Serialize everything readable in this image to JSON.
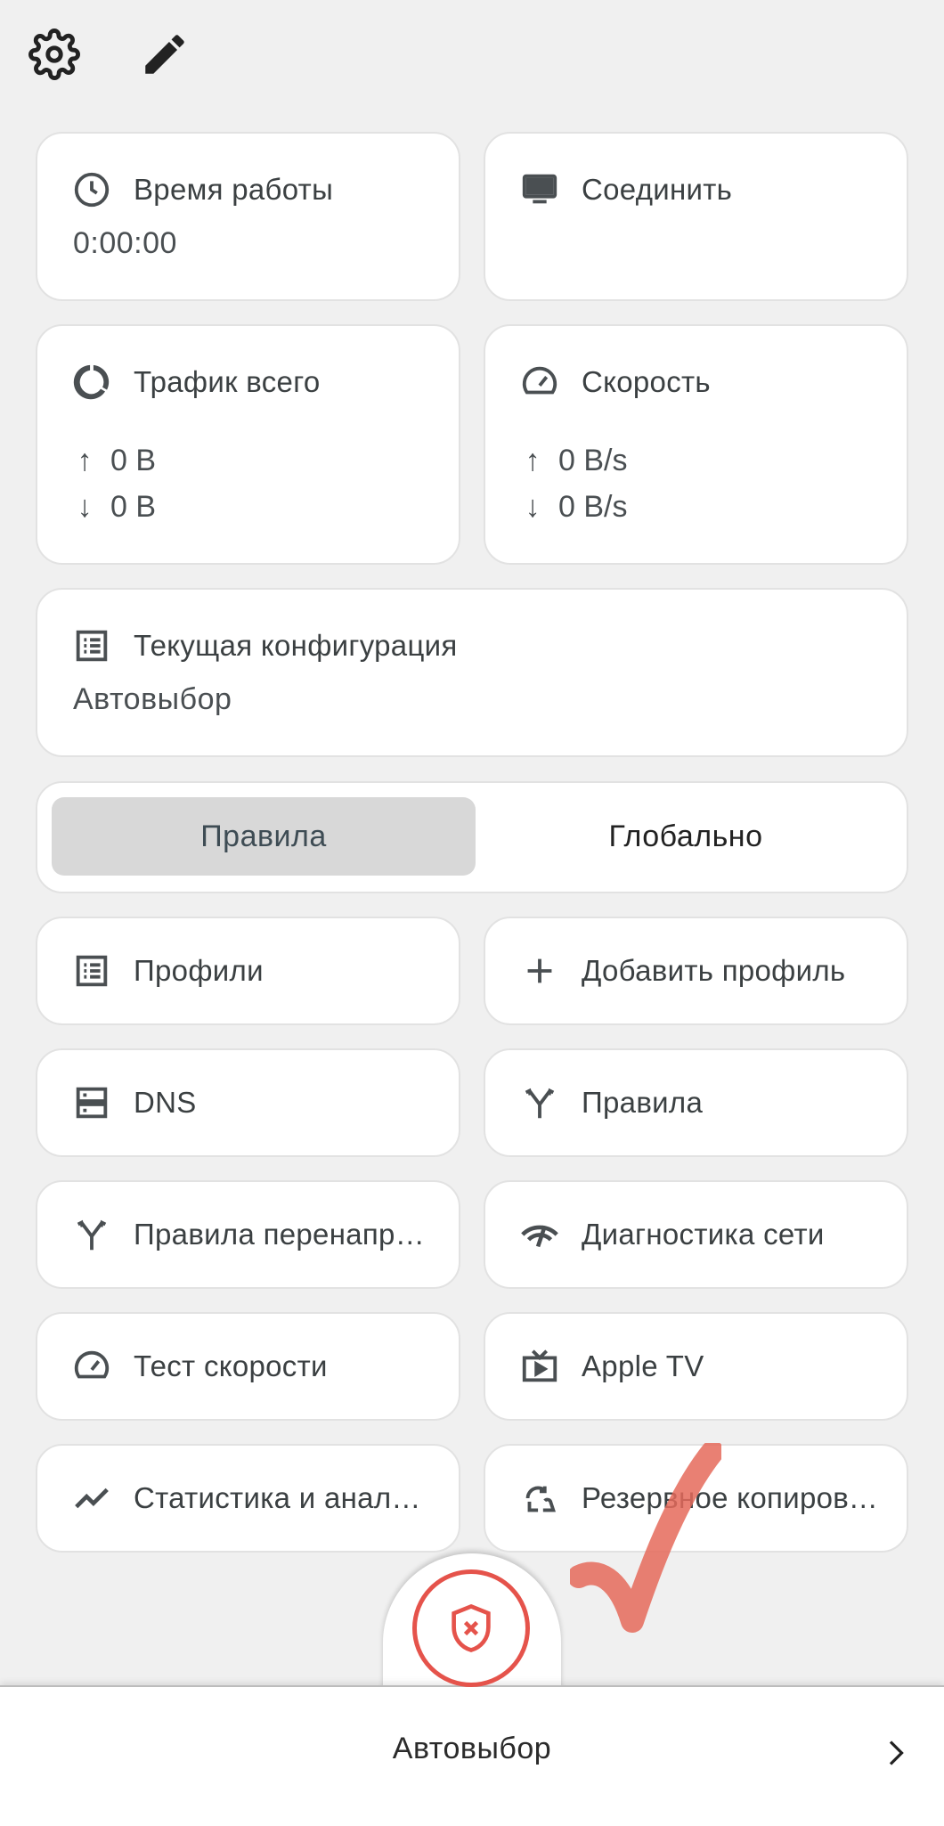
{
  "toolbar": {
    "settings_icon": "gear-icon",
    "edit_icon": "pencil-icon"
  },
  "uptime": {
    "title": "Время работы",
    "value": "0:00:00",
    "icon": "clock-icon"
  },
  "connect": {
    "title": "Соединить",
    "icon": "monitor-icon"
  },
  "traffic": {
    "title": "Трафик всего",
    "up": "0 B",
    "down": "0 B",
    "icon": "donut-icon"
  },
  "speed": {
    "title": "Скорость",
    "up": "0 B/s",
    "down": "0 B/s",
    "icon": "speedometer-icon"
  },
  "config": {
    "title": "Текущая конфигурация",
    "value": "Автовыбор",
    "icon": "list-icon"
  },
  "mode": {
    "left": "Правила",
    "right": "Глобально",
    "selected": "left"
  },
  "tiles": [
    {
      "label": "Профили",
      "icon": "list-icon"
    },
    {
      "label": "Добавить профиль",
      "icon": "plus-icon"
    },
    {
      "label": "DNS",
      "icon": "server-icon"
    },
    {
      "label": "Правила",
      "icon": "fork-icon"
    },
    {
      "label": "Правила перенаправления",
      "icon": "fork-icon"
    },
    {
      "label": "Диагностика сети",
      "icon": "network-check-icon"
    },
    {
      "label": "Тест скорости",
      "icon": "speedometer-icon"
    },
    {
      "label": "Apple TV",
      "icon": "tv-icon"
    },
    {
      "label": "Статистика и аналитика",
      "icon": "trend-icon"
    },
    {
      "label": "Резервное копирование",
      "icon": "backup-icon"
    }
  ],
  "bottom": {
    "label": "Автовыбор",
    "chevron_icon": "chevron-right-icon",
    "fab_icon": "shield-x-icon"
  },
  "colors": {
    "background": "#f0f0f0",
    "card": "#ffffff",
    "accent_red": "#e5534b",
    "segment_selected": "#d8d8d8",
    "text": "#3b4042"
  }
}
